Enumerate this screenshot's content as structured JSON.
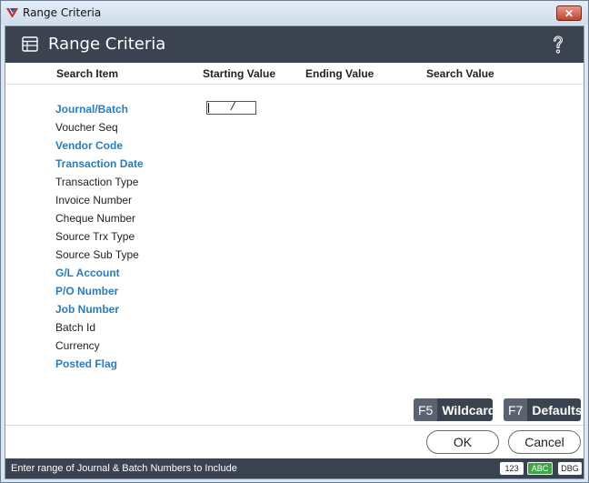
{
  "window": {
    "title": "Range Criteria"
  },
  "header": {
    "title": "Range Criteria",
    "help_icon": "question-mark-icon"
  },
  "columns": [
    "Search Item",
    "Starting Value",
    "Ending Value",
    "Search Value"
  ],
  "rows": [
    {
      "label": "Journal/Batch",
      "bold": true
    },
    {
      "label": "Voucher Seq",
      "bold": false
    },
    {
      "label": "Vendor Code",
      "bold": true
    },
    {
      "label": "Transaction Date",
      "bold": true
    },
    {
      "label": "Transaction Type",
      "bold": false
    },
    {
      "label": "Invoice Number",
      "bold": false
    },
    {
      "label": "Cheque Number",
      "bold": false
    },
    {
      "label": "Source Trx Type",
      "bold": false
    },
    {
      "label": "Source Sub Type",
      "bold": false
    },
    {
      "label": "G/L Account",
      "bold": true
    },
    {
      "label": "P/O Number",
      "bold": true
    },
    {
      "label": "Job Number",
      "bold": true
    },
    {
      "label": "Batch Id",
      "bold": false
    },
    {
      "label": "Currency",
      "bold": false
    },
    {
      "label": "Posted Flag",
      "bold": true
    }
  ],
  "start_input": {
    "value": "   /"
  },
  "fkeys": {
    "wildcard": {
      "key": "F5",
      "label": "Wildcard"
    },
    "defaults": {
      "key": "F7",
      "label": "Defaults"
    }
  },
  "buttons": {
    "ok": "OK",
    "cancel": "Cancel"
  },
  "status": {
    "text": "Enter range of Journal & Batch Numbers to Include",
    "badges": [
      {
        "label": "123",
        "bg": "#ffffff",
        "fg": "#222222"
      },
      {
        "label": "ABC",
        "bg": "#3fa845",
        "fg": "#ffffff"
      },
      {
        "label": "DBG",
        "bg": "#ffffff",
        "fg": "#222222"
      }
    ]
  },
  "colors": {
    "header_bg": "#3b4250",
    "link_blue": "#2a7bbf"
  }
}
